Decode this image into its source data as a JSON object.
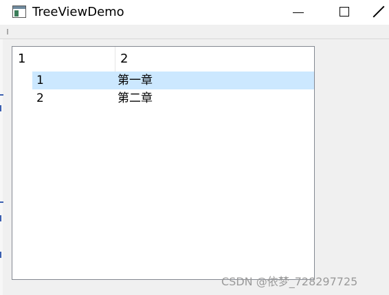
{
  "window": {
    "title": "TreeViewDemo",
    "icon": "app-window-icon"
  },
  "tree": {
    "headers": [
      "1",
      "2"
    ],
    "rows": [
      {
        "col1": "1",
        "col2": "第一章",
        "selected": true
      },
      {
        "col1": "2",
        "col2": "第二章",
        "selected": false
      }
    ]
  },
  "watermark": "CSDN @依梦_728297725",
  "colors": {
    "selection": "#cce8ff",
    "border": "#828790",
    "background": "#f0f0f0"
  }
}
